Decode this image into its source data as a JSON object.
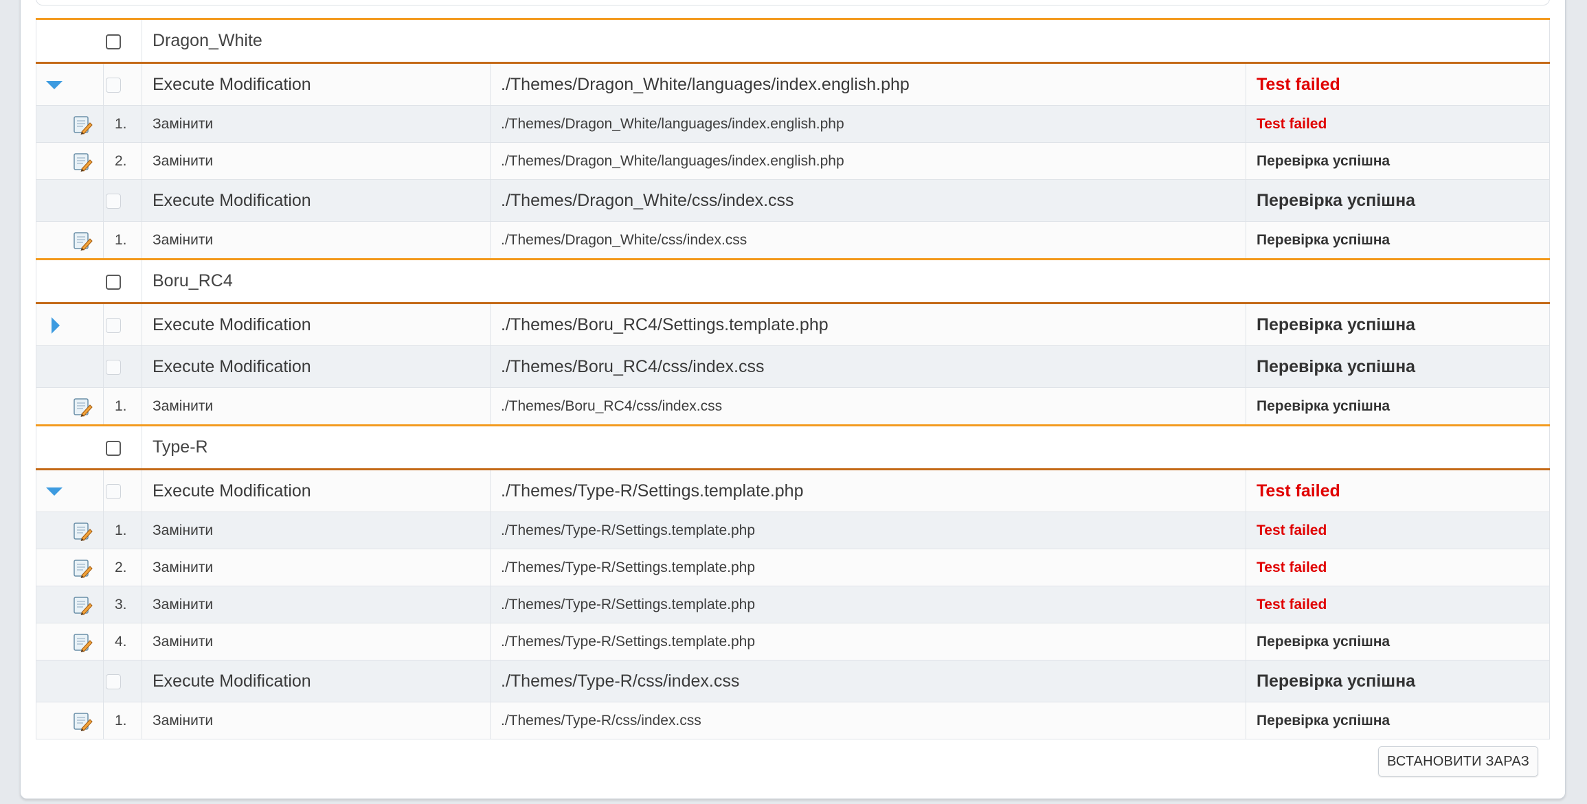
{
  "colors": {
    "failed": "#e00000",
    "theme_border": "#f39a1e",
    "toggle": "#3d9be0"
  },
  "themes": [
    {
      "name": "Dragon_White",
      "files": [
        {
          "toggle": "down",
          "label": "Execute Modification",
          "path": "./Themes/Dragon_White/languages/index.english.php",
          "status": "Test failed",
          "failed": true,
          "ops": [
            {
              "num": "1.",
              "action": "Замінити",
              "path": "./Themes/Dragon_White/languages/index.english.php",
              "status": "Test failed",
              "failed": true
            },
            {
              "num": "2.",
              "action": "Замінити",
              "path": "./Themes/Dragon_White/languages/index.english.php",
              "status": "Перевірка успішна",
              "failed": false
            }
          ]
        },
        {
          "toggle": "none",
          "label": "Execute Modification",
          "path": "./Themes/Dragon_White/css/index.css",
          "status": "Перевірка успішна",
          "failed": false,
          "ops": [
            {
              "num": "1.",
              "action": "Замінити",
              "path": "./Themes/Dragon_White/css/index.css",
              "status": "Перевірка успішна",
              "failed": false
            }
          ]
        }
      ]
    },
    {
      "name": "Boru_RC4",
      "files": [
        {
          "toggle": "right",
          "label": "Execute Modification",
          "path": "./Themes/Boru_RC4/Settings.template.php",
          "status": "Перевірка успішна",
          "failed": false,
          "ops": []
        },
        {
          "toggle": "none",
          "label": "Execute Modification",
          "path": "./Themes/Boru_RC4/css/index.css",
          "status": "Перевірка успішна",
          "failed": false,
          "ops": [
            {
              "num": "1.",
              "action": "Замінити",
              "path": "./Themes/Boru_RC4/css/index.css",
              "status": "Перевірка успішна",
              "failed": false
            }
          ]
        }
      ]
    },
    {
      "name": "Type-R",
      "files": [
        {
          "toggle": "down",
          "label": "Execute Modification",
          "path": "./Themes/Type-R/Settings.template.php",
          "status": "Test failed",
          "failed": true,
          "ops": [
            {
              "num": "1.",
              "action": "Замінити",
              "path": "./Themes/Type-R/Settings.template.php",
              "status": "Test failed",
              "failed": true
            },
            {
              "num": "2.",
              "action": "Замінити",
              "path": "./Themes/Type-R/Settings.template.php",
              "status": "Test failed",
              "failed": true
            },
            {
              "num": "3.",
              "action": "Замінити",
              "path": "./Themes/Type-R/Settings.template.php",
              "status": "Test failed",
              "failed": true
            },
            {
              "num": "4.",
              "action": "Замінити",
              "path": "./Themes/Type-R/Settings.template.php",
              "status": "Перевірка успішна",
              "failed": false
            }
          ]
        },
        {
          "toggle": "none",
          "label": "Execute Modification",
          "path": "./Themes/Type-R/css/index.css",
          "status": "Перевірка успішна",
          "failed": false,
          "ops": [
            {
              "num": "1.",
              "action": "Замінити",
              "path": "./Themes/Type-R/css/index.css",
              "status": "Перевірка успішна",
              "failed": false
            }
          ]
        }
      ]
    }
  ],
  "install_button": {
    "label": "ВСТАНОВИТИ ЗАРАЗ"
  }
}
